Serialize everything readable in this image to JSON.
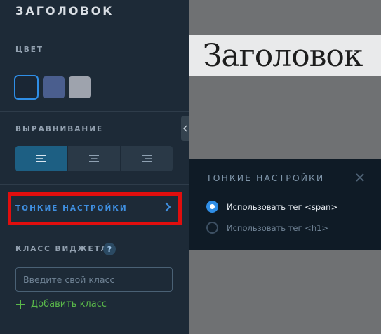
{
  "panel": {
    "title": "ЗАГОЛОВОК",
    "color_label": "ЦВЕТ",
    "swatches": [
      {
        "name": "swatch-dark-navy",
        "color": "#1a2634",
        "selected": true
      },
      {
        "name": "swatch-slate-blue",
        "color": "#4a5e8e",
        "selected": false
      },
      {
        "name": "swatch-light-gray",
        "color": "#9ea3ad",
        "selected": false
      }
    ],
    "alignment_label": "ВЫРАВНИВАНИЕ",
    "alignment_options": [
      {
        "icon": "align-left-icon",
        "active": true
      },
      {
        "icon": "align-center-icon",
        "active": false
      },
      {
        "icon": "align-right-icon",
        "active": false
      }
    ],
    "fine_settings_label": "ТОНКИЕ НАСТРОЙКИ",
    "widget_class_label": "КЛАСС ВИДЖЕТА",
    "help_icon": "?",
    "class_input": {
      "value": "",
      "placeholder": "Введите свой класс"
    },
    "add_class_label": "Добавить класс"
  },
  "preview": {
    "heading_text": "Заголовок"
  },
  "popup": {
    "title": "ТОНКИЕ НАСТРОЙКИ",
    "options": [
      {
        "label": "Использовать тег <span>",
        "checked": true
      },
      {
        "label": "Использовать тег <h1>",
        "checked": false
      }
    ]
  },
  "colors": {
    "accent_blue": "#2f8ee6",
    "highlight_red": "#e10e0e",
    "add_green": "#5ab94a"
  }
}
